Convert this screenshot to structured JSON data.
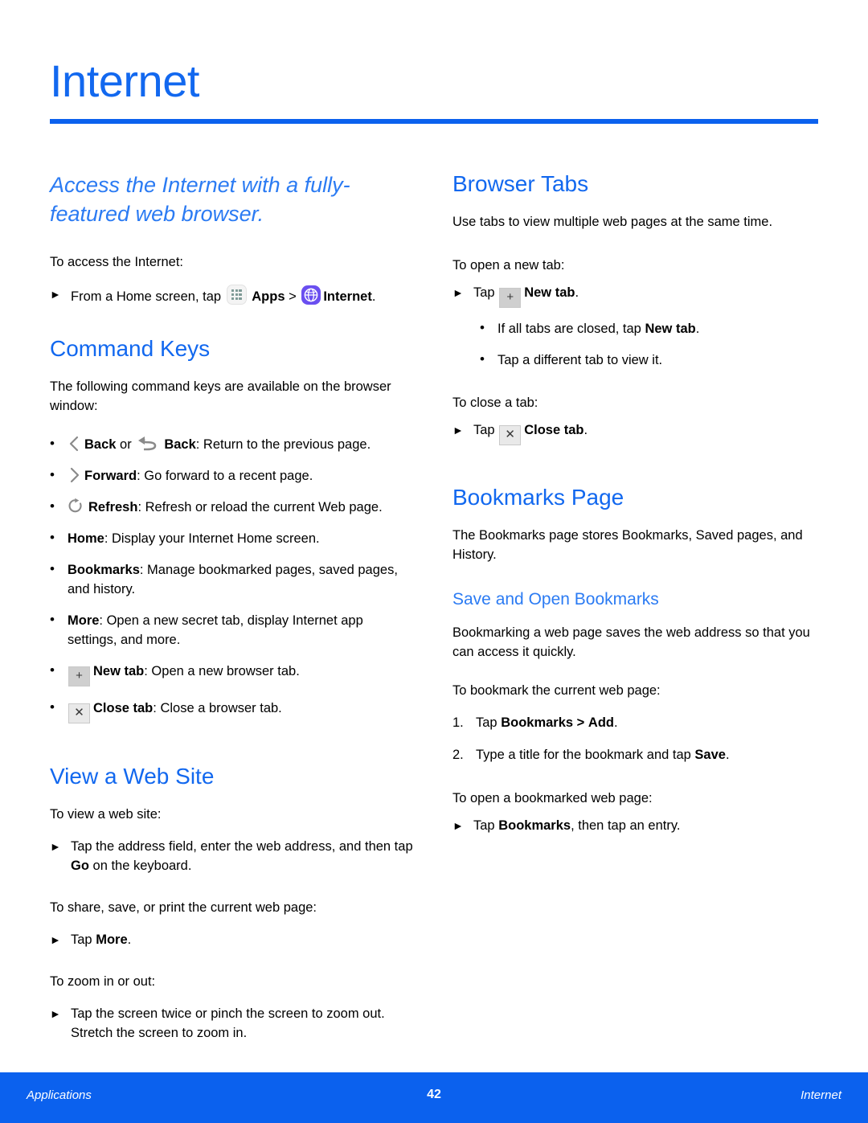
{
  "header": {
    "title": "Internet"
  },
  "colors": {
    "accent_blue": "#0b61ee",
    "heading_blue": "#1268ef",
    "lead_blue": "#2b7bf3",
    "internet_icon_purple": "#6a4ff0",
    "apps_icon_dot": "#7f9a96"
  },
  "left_column": {
    "lead": "Access the Internet with a fully-featured web browser.",
    "access_intro": "To access the Internet:",
    "access_step": {
      "prefix": "From a Home screen, tap",
      "apps_label": "Apps",
      "separator": ">",
      "internet_label": "Internet",
      "suffix": "."
    },
    "command_keys": {
      "heading": "Command Keys",
      "intro": "The following command keys are available on the browser window:",
      "items": [
        {
          "key1": "Back",
          "joiner": "or",
          "key2": "Back",
          "desc": ": Return to the previous page."
        },
        {
          "key": "Forward",
          "desc": ": Go forward to a recent page."
        },
        {
          "key": "Refresh",
          "desc": ": Refresh or reload the current Web page."
        },
        {
          "key": "Home",
          "desc": ": Display your Internet Home screen."
        },
        {
          "key": "Bookmarks",
          "desc": ": Manage bookmarked pages, saved pages, and history."
        },
        {
          "key": "More",
          "desc": ": Open a new secret tab, display Internet app settings, and more."
        },
        {
          "key": "New tab",
          "desc": ": Open a new browser tab."
        },
        {
          "key": "Close tab",
          "desc": ": Close a browser tab."
        }
      ]
    },
    "view_web_site": {
      "heading": "View a Web Site",
      "intro": "To view a web site:",
      "step": {
        "before": "Tap the address field, enter the web address, and then tap",
        "bold": "Go",
        "after": "on the keyboard."
      },
      "share_intro": "To share, save, or print the current web page:",
      "share_step": {
        "before": "Tap",
        "bold": "More",
        "after": "."
      },
      "zoom_intro": "To zoom in or out:",
      "zoom_step": "Tap the screen twice or pinch the screen to zoom out. Stretch the screen to zoom in."
    }
  },
  "right_column": {
    "browser_tabs": {
      "heading": "Browser Tabs",
      "intro": "Use tabs to view multiple web pages at the same time.",
      "open_intro": "To open a new tab:",
      "open_step": {
        "before": "Tap",
        "bold": "New tab",
        "after": "."
      },
      "sub_bullets": [
        {
          "before": "If all tabs are closed, tap",
          "bold": "New tab",
          "after": "."
        },
        {
          "before": "Tap a different tab to view it.",
          "bold": "",
          "after": ""
        }
      ],
      "close_intro": "To close a tab:",
      "close_step": {
        "before": "Tap",
        "bold": "Close tab",
        "after": "."
      }
    },
    "bookmarks_page": {
      "heading": "Bookmarks Page",
      "intro": "The Bookmarks page stores Bookmarks, Saved pages, and History.",
      "subheading": "Save and Open Bookmarks",
      "desc": "Bookmarking a web page saves the web address so that you can access it quickly.",
      "bookmark_intro": "To bookmark the current web page:",
      "steps": [
        {
          "number": "1.",
          "before": "Tap",
          "bold1": "Bookmarks",
          "middle": ">",
          "bold2": "Add",
          "after": "."
        },
        {
          "number": "2.",
          "before": "Type a title for the bookmark and tap",
          "bold1": "Save",
          "middle": "",
          "bold2": "",
          "after": "."
        }
      ],
      "open_intro": "To open a bookmarked web page:",
      "open_step": {
        "before": "Tap",
        "bold": "Bookmarks",
        "after": ", then tap an entry."
      }
    }
  },
  "footer": {
    "left": "Applications",
    "page_number": "42",
    "right": "Internet"
  }
}
